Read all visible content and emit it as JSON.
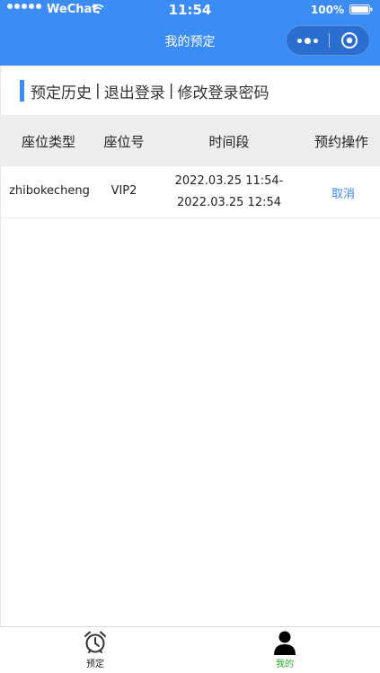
{
  "status_bar": {
    "carrier": "WeChat",
    "time": "11:54",
    "battery": "100%"
  },
  "nav": {
    "title": "我的预定"
  },
  "header": {
    "history_link": "预定历史",
    "separator": "|",
    "logout_link": "退出登录",
    "change_password_link": "修改登录密码"
  },
  "table": {
    "columns": [
      "座位类型",
      "座位号",
      "时间段",
      "预约操作"
    ],
    "rows": [
      {
        "seat_type": "zhibokecheng",
        "seat_no": "VIP2",
        "time_start": "2022.03.25 11:54-",
        "time_end": "2022.03.25 12:54",
        "action": "取消"
      }
    ]
  },
  "tabbar": {
    "items": [
      {
        "label": "预定",
        "icon": "alarm-clock-icon",
        "active": false
      },
      {
        "label": "我的",
        "icon": "person-icon",
        "active": true
      }
    ]
  },
  "colors": {
    "brand_blue": "#3b8cf5",
    "active_tab": "#2aa52a"
  }
}
